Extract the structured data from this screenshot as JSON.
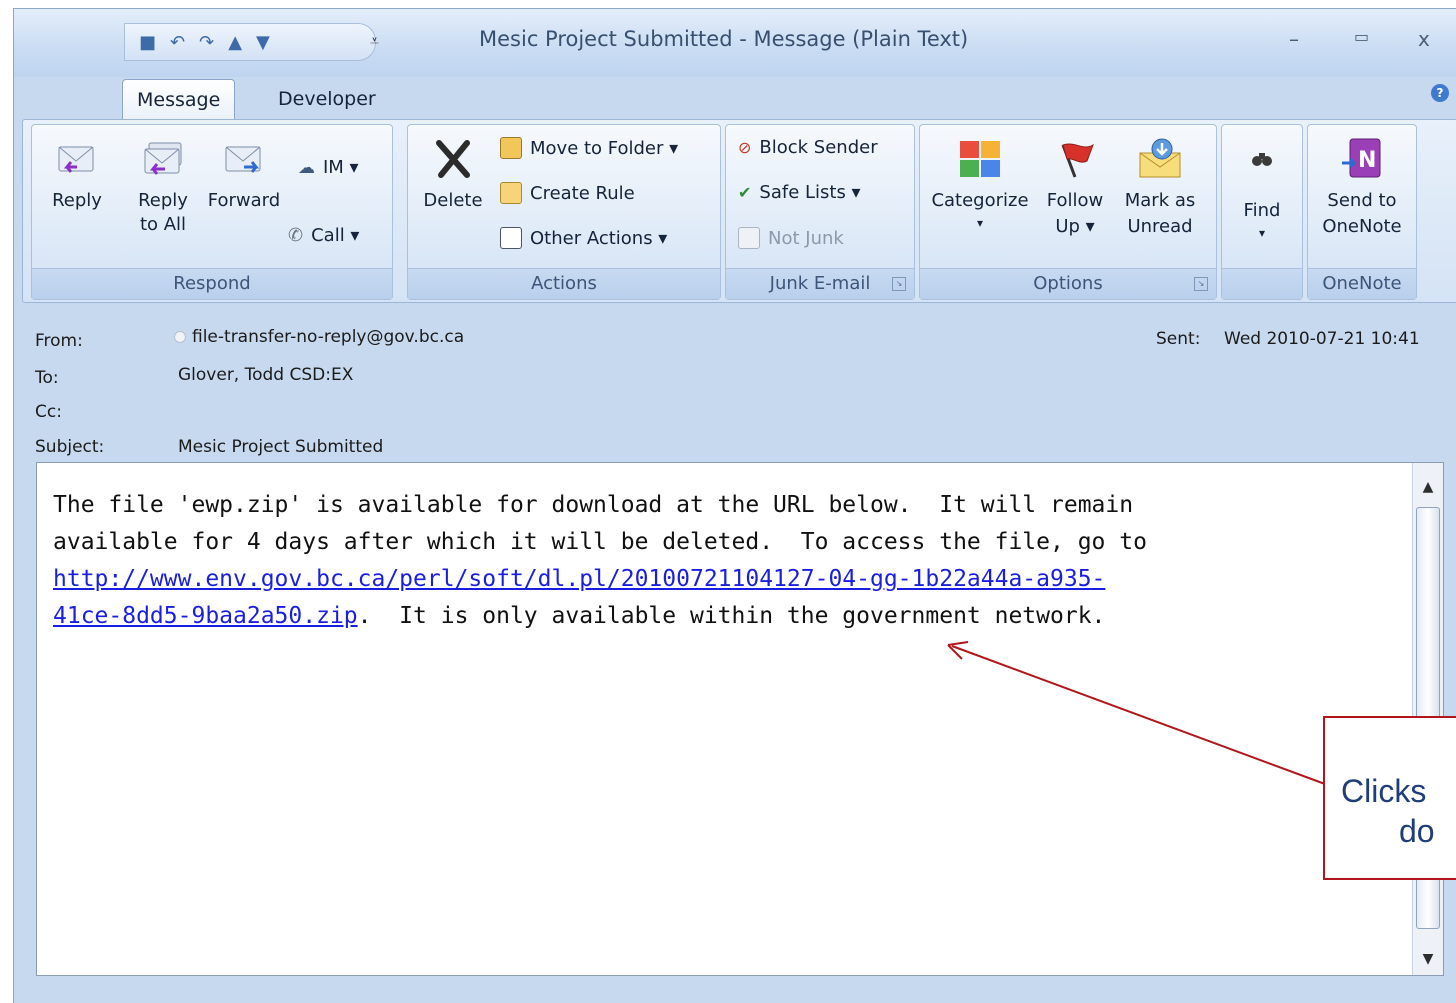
{
  "window": {
    "title": "Mesic Project Submitted - Message (Plain Text)",
    "minimize": "–",
    "maximize": "▭",
    "close": "x",
    "help": "?"
  },
  "tabs": [
    {
      "label": "Message",
      "active": true
    },
    {
      "label": "Developer",
      "active": false
    }
  ],
  "ribbon": {
    "respond": {
      "label": "Respond",
      "reply": "Reply",
      "reply_all_1": "Reply",
      "reply_all_2": "to All",
      "forward": "Forward",
      "im": "IM ▾",
      "call": "Call ▾"
    },
    "actions": {
      "label": "Actions",
      "delete": "Delete",
      "move_to_folder": "Move to Folder ▾",
      "create_rule": "Create Rule",
      "other_actions": "Other Actions ▾"
    },
    "junk": {
      "label": "Junk E-mail",
      "block_sender": "Block Sender",
      "safe_lists": "Safe Lists ▾",
      "not_junk": "Not Junk"
    },
    "options": {
      "label": "Options",
      "categorize_1": "Categorize",
      "categorize_2": "▾",
      "follow_up_1": "Follow",
      "follow_up_2": "Up ▾",
      "mark_as_unread_1": "Mark as",
      "mark_as_unread_2": "Unread"
    },
    "find": {
      "label": "",
      "find_1": "Find",
      "find_2": "▾"
    },
    "onenote": {
      "label": "OneNote",
      "send_1": "Send to",
      "send_2": "OneNote"
    }
  },
  "header": {
    "from_label": "From:",
    "from_value": "file-transfer-no-reply@gov.bc.ca",
    "sent_label": "Sent:",
    "sent_value": "Wed 2010-07-21 10:41",
    "to_label": "To:",
    "to_value": "Glover, Todd CSD:EX",
    "cc_label": "Cc:",
    "cc_value": "",
    "subject_label": "Subject:",
    "subject_value": "Mesic Project Submitted"
  },
  "message": {
    "line1": "The file 'ewp.zip' is available for download at the URL below.  It will remain",
    "line2": "available for 4 days after which it will be deleted.  To access the file, go to",
    "link_part1": "http://www.env.gov.bc.ca/perl/soft/dl.pl/20100721104127-04-gg-1b22a44a-a935-",
    "link_part2": "41ce-8dd5-9baa2a50.zip",
    "line4_rest": ".  It is only available within the government network."
  },
  "callout": {
    "line1": "Clicks",
    "line2": "do"
  },
  "colors": {
    "callout_border": "#b0161c",
    "callout_arrow": "#b0161c",
    "link": "#1a1ee0"
  }
}
